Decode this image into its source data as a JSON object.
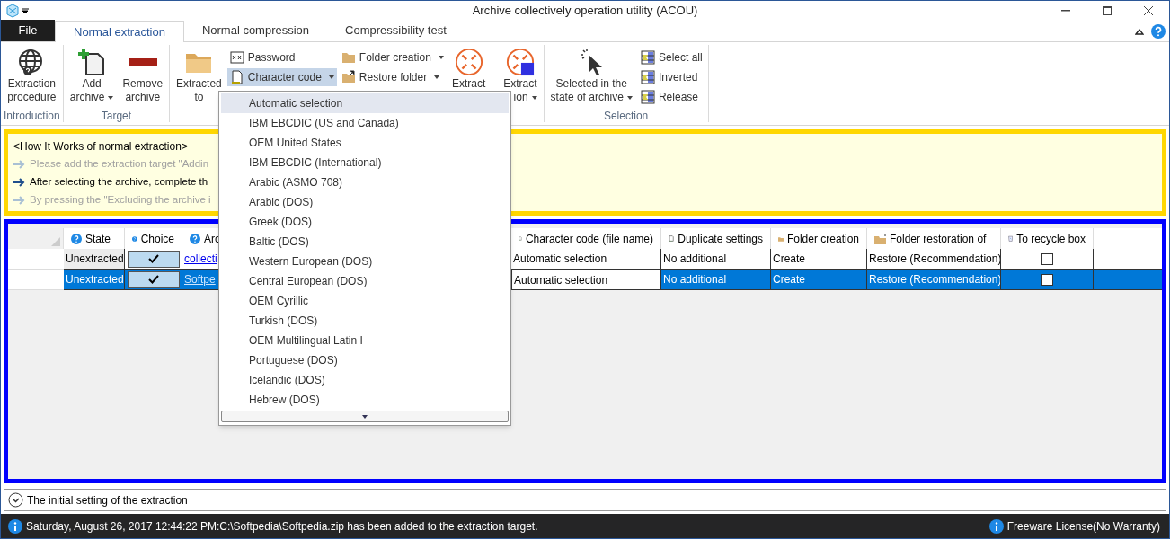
{
  "window": {
    "title": "Archive collectively operation utility (ACOU)"
  },
  "file_menu": "File",
  "tabs": [
    {
      "label": "Normal extraction",
      "selected": true
    },
    {
      "label": "Normal compression",
      "selected": false
    },
    {
      "label": "Compressibility test",
      "selected": false
    }
  ],
  "ribbon": {
    "groups": [
      {
        "label": "Introduction",
        "items": [
          {
            "kind": "large",
            "lines": [
              "Extraction",
              "procedure"
            ],
            "dropdown": false
          }
        ]
      },
      {
        "label": "Target",
        "items": [
          {
            "kind": "large",
            "lines": [
              "Add",
              "archive"
            ],
            "dropdown": true
          },
          {
            "kind": "large",
            "lines": [
              "Remove",
              "archive"
            ],
            "dropdown": false
          }
        ]
      },
      {
        "items": [
          {
            "kind": "large",
            "lines": [
              "Extracted",
              "to"
            ],
            "dropdown": false
          },
          {
            "kind": "stack",
            "items": [
              {
                "label": "Password",
                "dropdown": false,
                "pressed": false
              },
              {
                "label": "Character code",
                "dropdown": true,
                "pressed": true
              }
            ]
          },
          {
            "kind": "stack",
            "items": [
              {
                "label": "Folder creation",
                "dropdown": true,
                "pressed": false
              },
              {
                "label": "Restore folder",
                "dropdown": true,
                "pressed": false
              }
            ]
          },
          {
            "kind": "large",
            "lines": [
              "Extract"
            ],
            "dropdown": false
          },
          {
            "kind": "large",
            "lines": [
              "Extract",
              "ion"
            ],
            "dropdown": true
          }
        ]
      },
      {
        "label": "Selection",
        "items": [
          {
            "kind": "large",
            "lines": [
              "Selected in the",
              "state of archive"
            ],
            "dropdown": true
          },
          {
            "kind": "stack",
            "items": [
              {
                "label": "Select all",
                "dropdown": false,
                "pressed": false
              },
              {
                "label": "Inverted",
                "dropdown": false,
                "pressed": false
              },
              {
                "label": "Release",
                "dropdown": false,
                "pressed": false
              }
            ]
          }
        ]
      }
    ]
  },
  "guide": {
    "title": "<How It Works of normal extraction>",
    "steps": [
      {
        "text": "Please add the extraction target \"Addin",
        "current": false
      },
      {
        "text": "After selecting the archive, complete th",
        "current": true
      },
      {
        "text": "By pressing the \"Excluding the archive i",
        "current": false
      }
    ]
  },
  "table": {
    "columns": [
      {
        "label": "State",
        "kind": "help"
      },
      {
        "label": "Choice",
        "kind": "help"
      },
      {
        "label": "Arc",
        "kind": "help"
      },
      {
        "label": "Character code (file name)",
        "kind": "charset"
      },
      {
        "label": "Duplicate settings",
        "kind": "charset"
      },
      {
        "label": "Folder creation",
        "kind": "folder"
      },
      {
        "label": "Folder restoration of",
        "kind": "restore"
      },
      {
        "label": "To recycle box",
        "kind": "recycle"
      }
    ],
    "rows": [
      {
        "selected": false,
        "editing": false,
        "state": "Unextracted",
        "choice": true,
        "archive": "collecti",
        "charset": "Automatic selection",
        "duplicate": "No additional",
        "folder": "Create",
        "restore": "Restore (Recommendation)",
        "recycle": false
      },
      {
        "selected": true,
        "editing": true,
        "state": "Unextracted",
        "choice": true,
        "archive": "Softpe",
        "charset": "Automatic selection",
        "duplicate": "No additional",
        "folder": "Create",
        "restore": "Restore (Recommendation)",
        "recycle": false
      }
    ]
  },
  "dropdown": {
    "options": [
      {
        "label": "Automatic selection",
        "selected": true
      },
      {
        "label": "IBM EBCDIC (US and Canada)",
        "selected": false
      },
      {
        "label": "OEM United States",
        "selected": false
      },
      {
        "label": "IBM EBCDIC (International)",
        "selected": false
      },
      {
        "label": "Arabic (ASMO 708)",
        "selected": false
      },
      {
        "label": "Arabic (DOS)",
        "selected": false
      },
      {
        "label": "Greek (DOS)",
        "selected": false
      },
      {
        "label": "Baltic (DOS)",
        "selected": false
      },
      {
        "label": "Western European (DOS)",
        "selected": false
      },
      {
        "label": "Central European (DOS)",
        "selected": false
      },
      {
        "label": "OEM Cyrillic",
        "selected": false
      },
      {
        "label": "Turkish (DOS)",
        "selected": false
      },
      {
        "label": "OEM Multilingual Latin I",
        "selected": false
      },
      {
        "label": "Portuguese (DOS)",
        "selected": false
      },
      {
        "label": "Icelandic (DOS)",
        "selected": false
      },
      {
        "label": "Hebrew (DOS)",
        "selected": false
      }
    ]
  },
  "settings_expander": {
    "label": "The initial setting of the extraction",
    "expanded": false
  },
  "status_bar": {
    "message": "Saturday, August 26, 2017 12:44:22 PM:C:\\Softpedia\\Softpedia.zip has been added to the extraction target.",
    "license": "Freeware License(No Warranty)"
  }
}
